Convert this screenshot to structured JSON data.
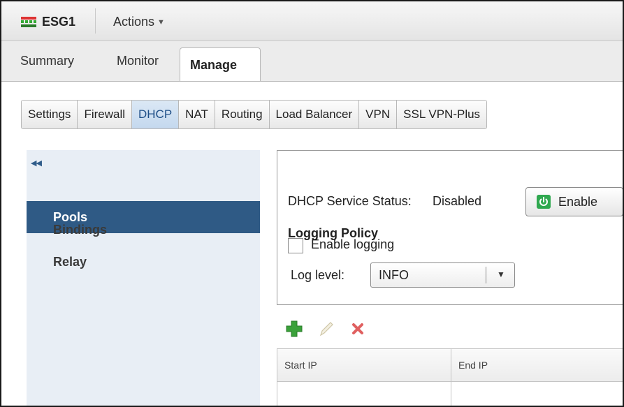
{
  "titlebar": {
    "title": "ESG1",
    "actions_label": "Actions",
    "app_icon": "edge-gateway-icon"
  },
  "main_tabs": [
    {
      "label": "Summary",
      "active": false
    },
    {
      "label": "Monitor",
      "active": false
    },
    {
      "label": "Manage",
      "active": true
    }
  ],
  "sub_tabs": [
    {
      "label": "Settings",
      "active": false
    },
    {
      "label": "Firewall",
      "active": false
    },
    {
      "label": "DHCP",
      "active": true
    },
    {
      "label": "NAT",
      "active": false
    },
    {
      "label": "Routing",
      "active": false
    },
    {
      "label": "Load Balancer",
      "active": false
    },
    {
      "label": "VPN",
      "active": false
    },
    {
      "label": "SSL VPN-Plus",
      "active": false
    }
  ],
  "left_nav": {
    "collapse_icon": "double-chevron-left-icon",
    "items": [
      {
        "label": "Pools",
        "active": true
      },
      {
        "label": "Bindings",
        "active": false
      },
      {
        "label": "Relay",
        "active": false
      }
    ]
  },
  "dhcp": {
    "status_label": "DHCP Service Status:",
    "status_value": "Disabled",
    "enable_button": "Enable",
    "logging_title": "Logging Policy",
    "enable_logging_label": "Enable logging",
    "enable_logging_checked": false,
    "log_level_label": "Log level:",
    "log_level_value": "INFO"
  },
  "toolbar": {
    "icons": [
      "add-icon",
      "edit-icon",
      "delete-icon"
    ]
  },
  "table": {
    "columns": [
      "Start IP",
      "End IP"
    ]
  },
  "colors": {
    "nav_active": "#2f5a85",
    "nav_bg": "#e8eef5",
    "tab_active": "#c4d8ee",
    "power_green": "#2fa84f",
    "add_green": "#3aa13a",
    "delete_red": "#e06060"
  }
}
